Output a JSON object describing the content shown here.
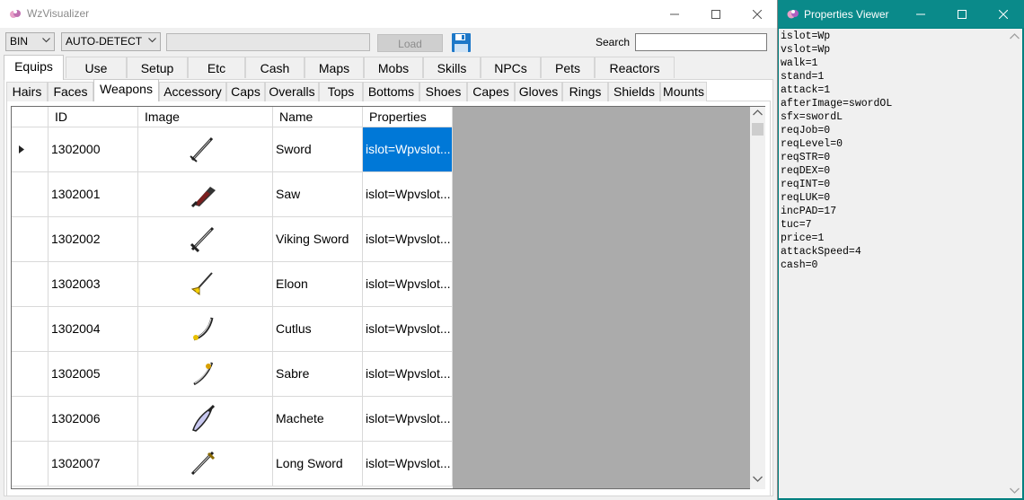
{
  "main_window": {
    "title": "WzVisualizer",
    "format_select": "BIN",
    "version_select": "AUTO-DETECT",
    "path_value": "",
    "load_label": "Load",
    "save_icon": "floppy-disk-icon",
    "search_label": "Search",
    "search_value": ""
  },
  "tabs": [
    "Equips",
    "Use",
    "Setup",
    "Etc",
    "Cash",
    "Maps",
    "Mobs",
    "Skills",
    "NPCs",
    "Pets",
    "Reactors"
  ],
  "sub_tabs": [
    "Hairs",
    "Faces",
    "Weapons",
    "Accessory",
    "Caps",
    "Overalls",
    "Tops",
    "Bottoms",
    "Shoes",
    "Capes",
    "Gloves",
    "Rings",
    "Shields",
    "Mounts"
  ],
  "table": {
    "columns": [
      "ID",
      "Image",
      "Name",
      "Properties"
    ],
    "rows": [
      {
        "id": "1302000",
        "name": "Sword",
        "props": "islot=Wpvslot...",
        "icon": "sword-icon"
      },
      {
        "id": "1302001",
        "name": "Saw",
        "props": "islot=Wpvslot...",
        "icon": "saw-icon"
      },
      {
        "id": "1302002",
        "name": "Viking Sword",
        "props": "islot=Wpvslot...",
        "icon": "viking-sword-icon"
      },
      {
        "id": "1302003",
        "name": "Eloon",
        "props": "islot=Wpvslot...",
        "icon": "eloon-icon"
      },
      {
        "id": "1302004",
        "name": "Cutlus",
        "props": "islot=Wpvslot...",
        "icon": "cutlus-icon"
      },
      {
        "id": "1302005",
        "name": "Sabre",
        "props": "islot=Wpvslot...",
        "icon": "sabre-icon"
      },
      {
        "id": "1302006",
        "name": "Machete",
        "props": "islot=Wpvslot...",
        "icon": "machete-icon"
      },
      {
        "id": "1302007",
        "name": "Long Sword",
        "props": "islot=Wpvslot...",
        "icon": "long-sword-icon"
      }
    ]
  },
  "properties_window": {
    "title": "Properties Viewer",
    "lines": [
      "islot=Wp",
      "vslot=Wp",
      "walk=1",
      "stand=1",
      "attack=1",
      "afterImage=swordOL",
      "sfx=swordL",
      "reqJob=0",
      "reqLevel=0",
      "reqSTR=0",
      "reqDEX=0",
      "reqINT=0",
      "reqLUK=0",
      "incPAD=17",
      "tuc=7",
      "price=1",
      "attackSpeed=4",
      "cash=0"
    ]
  }
}
